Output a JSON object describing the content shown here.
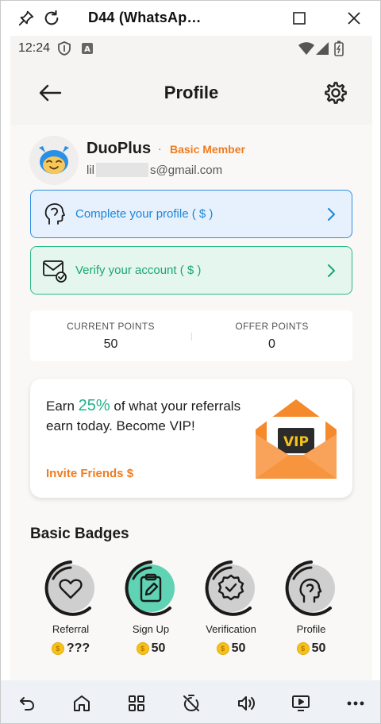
{
  "window": {
    "title": "D44  (WhatsAp…",
    "pin_icon": "pin-icon",
    "refresh_icon": "refresh-icon",
    "maximize_icon": "maximize-icon",
    "close_icon": "close-icon"
  },
  "status_bar": {
    "time": "12:24",
    "icons": [
      "shield-icon",
      "a-icon",
      "wifi-icon",
      "signal-icon",
      "battery-icon"
    ]
  },
  "header": {
    "title": "Profile",
    "back_icon": "back-arrow-icon",
    "settings_icon": "gear-icon"
  },
  "profile": {
    "name": "DuoPlus",
    "separator": "·",
    "membership": "Basic Member",
    "email_prefix": "lil",
    "email_suffix": "s@gmail.com"
  },
  "actions": [
    {
      "label": "Complete your profile ( $ )",
      "icon": "head-profile-icon",
      "color": "#1b86d8"
    },
    {
      "label": "Verify your account ( $ )",
      "icon": "mail-verify-icon",
      "color": "#1aa871"
    }
  ],
  "points": {
    "current_label": "CURRENT POINTS",
    "current_value": "50",
    "offer_label": "OFFER POINTS",
    "offer_value": "0"
  },
  "referral": {
    "text_before": "Earn ",
    "percent": "25%",
    "text_after": " of what your referrals earn today. Become VIP!",
    "invite_label": "Invite Friends $",
    "envelope_text": "VIP"
  },
  "badges": {
    "title": "Basic Badges",
    "items": [
      {
        "name": "Referral",
        "value": "???",
        "icon": "heart-icon",
        "progress": 0.0
      },
      {
        "name": "Sign Up",
        "value": "50",
        "icon": "clipboard-edit-icon",
        "progress": 1.0
      },
      {
        "name": "Verification",
        "value": "50",
        "icon": "verified-badge-icon",
        "progress": 0.0
      },
      {
        "name": "Profile",
        "value": "50",
        "icon": "head-profile-icon",
        "progress": 0.0
      }
    ]
  },
  "nav": {
    "icons": [
      "back-icon",
      "home-icon",
      "apps-icon",
      "timer-off-icon",
      "volume-icon",
      "screen-icon",
      "more-icon"
    ]
  },
  "colors": {
    "accent_orange": "#f07c1e",
    "blue": "#2f8de4",
    "green": "#2dbb85",
    "teal": "#22b08a"
  }
}
